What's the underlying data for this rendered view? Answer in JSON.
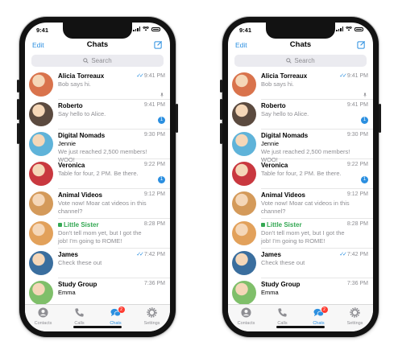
{
  "status": {
    "time": "9:41"
  },
  "nav": {
    "edit": "Edit",
    "title": "Chats"
  },
  "search": {
    "placeholder": "Search"
  },
  "chats": [
    {
      "name": "Alicia Torreaux",
      "sender": "",
      "message": "Bob says hi.",
      "time": "9:41 PM",
      "read": true,
      "pinned": true,
      "badge": "",
      "green": false,
      "avatar": "#d9734c"
    },
    {
      "name": "Roberto",
      "sender": "",
      "message": "Say hello to Alice.",
      "time": "9:41 PM",
      "read": false,
      "pinned": false,
      "badge": "1",
      "green": false,
      "avatar": "#5b4a3f"
    },
    {
      "name": "Digital Nomads",
      "sender": "Jennie",
      "message": "We just reached 2,500 members! WOO!",
      "time": "9:30 PM",
      "read": false,
      "pinned": false,
      "badge": "",
      "green": false,
      "avatar": "#5fb3d9"
    },
    {
      "name": "Veronica",
      "sender": "",
      "message": "Table for four, 2 PM. Be there.",
      "time": "9:22 PM",
      "read": false,
      "pinned": false,
      "badge": "1",
      "green": false,
      "avatar": "#c9383f"
    },
    {
      "name": "Animal Videos",
      "sender": "",
      "message": "Vote now! Moar cat videos in this channel?",
      "time": "9:12 PM",
      "read": false,
      "pinned": false,
      "badge": "",
      "green": false,
      "avatar": "#d49a5a"
    },
    {
      "name": "Little Sister",
      "sender": "",
      "message": "Don't tell mom yet, but I got the job! I'm going to ROME!",
      "time": "8:28 PM",
      "read": false,
      "pinned": false,
      "badge": "",
      "green": true,
      "avatar": "#e2a15b"
    },
    {
      "name": "James",
      "sender": "",
      "message": "Check these out",
      "time": "7:42 PM",
      "read": true,
      "pinned": false,
      "badge": "",
      "green": false,
      "avatar": "#3a6e9e"
    },
    {
      "name": "Study Group",
      "sender": "Emma",
      "message": "",
      "time": "7:36 PM",
      "read": false,
      "pinned": false,
      "badge": "",
      "green": false,
      "avatar": "#7fbf6a"
    }
  ],
  "tabs": [
    {
      "label": "Contacts",
      "icon": "person-icon",
      "active": false,
      "badge": ""
    },
    {
      "label": "Calls",
      "icon": "phone-icon",
      "active": false,
      "badge": ""
    },
    {
      "label": "Chats",
      "icon": "chat-bubbles-icon",
      "active": true,
      "badge": "2"
    },
    {
      "label": "Settings",
      "icon": "gear-icon",
      "active": false,
      "badge": ""
    }
  ],
  "colors": {
    "accent": "#2b8fe0",
    "green": "#34a853",
    "badge_red": "#ff3b30"
  }
}
